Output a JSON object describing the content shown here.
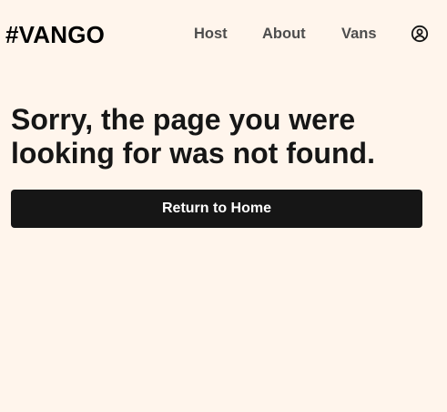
{
  "header": {
    "logo": "#VANGO",
    "nav": {
      "host": "Host",
      "about": "About",
      "vans": "Vans"
    },
    "account_icon": "user-circle-icon"
  },
  "main": {
    "headline": "Sorry, the page you were looking for was not found.",
    "return_button_label": "Return to Home"
  },
  "colors": {
    "background": "#FFF5EC",
    "text": "#161616",
    "nav_text": "#4D4D4D",
    "button_bg": "#161616",
    "button_text": "#FFFFFF"
  }
}
